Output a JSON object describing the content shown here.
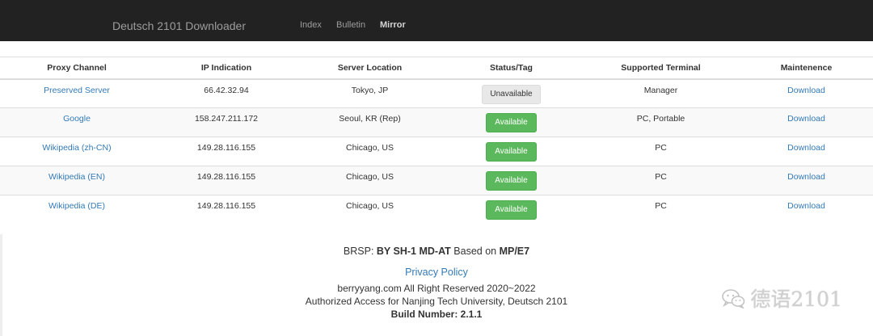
{
  "nav": {
    "brand": "Deutsch 2101 Downloader",
    "links": [
      {
        "label": "Index",
        "active": false
      },
      {
        "label": "Bulletin",
        "active": false
      },
      {
        "label": "Mirror",
        "active": true
      }
    ]
  },
  "table": {
    "headers": [
      "Proxy Channel",
      "IP Indication",
      "Server Location",
      "Status/Tag",
      "Supported Terminal",
      "Maintenence"
    ],
    "rows": [
      {
        "channel": "Preserved Server",
        "ip": "66.42.32.94",
        "location": "Tokyo, JP",
        "status": "Unavailable",
        "terminal": "Manager",
        "action": "Download"
      },
      {
        "channel": "Google",
        "ip": "158.247.211.172",
        "location": "Seoul, KR (Rep)",
        "status": "Available",
        "terminal": "PC, Portable",
        "action": "Download"
      },
      {
        "channel": "Wikipedia (zh-CN)",
        "ip": "149.28.116.155",
        "location": "Chicago, US",
        "status": "Available",
        "terminal": "PC",
        "action": "Download"
      },
      {
        "channel": "Wikipedia (EN)",
        "ip": "149.28.116.155",
        "location": "Chicago, US",
        "status": "Available",
        "terminal": "PC",
        "action": "Download"
      },
      {
        "channel": "Wikipedia (DE)",
        "ip": "149.28.116.155",
        "location": "Chicago, US",
        "status": "Available",
        "terminal": "PC",
        "action": "Download"
      }
    ]
  },
  "footer": {
    "brsp_prefix": "BRSP: ",
    "brsp_code": "BY SH-1 MD-AT",
    "brsp_mid": " Based on ",
    "brsp_base": "MP/E7",
    "privacy": "Privacy Policy",
    "rights": "berryyang.com All Right Reserved 2020~2022",
    "access": "Authorized Access for Nanjing Tech University, Deutsch 2101",
    "build": "Build Number: 2.1.1"
  },
  "watermark": {
    "text": "德语2101",
    "icon": "wechat-icon"
  },
  "colors": {
    "navbar": "#222222",
    "link": "#337ab7",
    "available": "#5cb85c",
    "unavailable": "#e8e8e8"
  }
}
